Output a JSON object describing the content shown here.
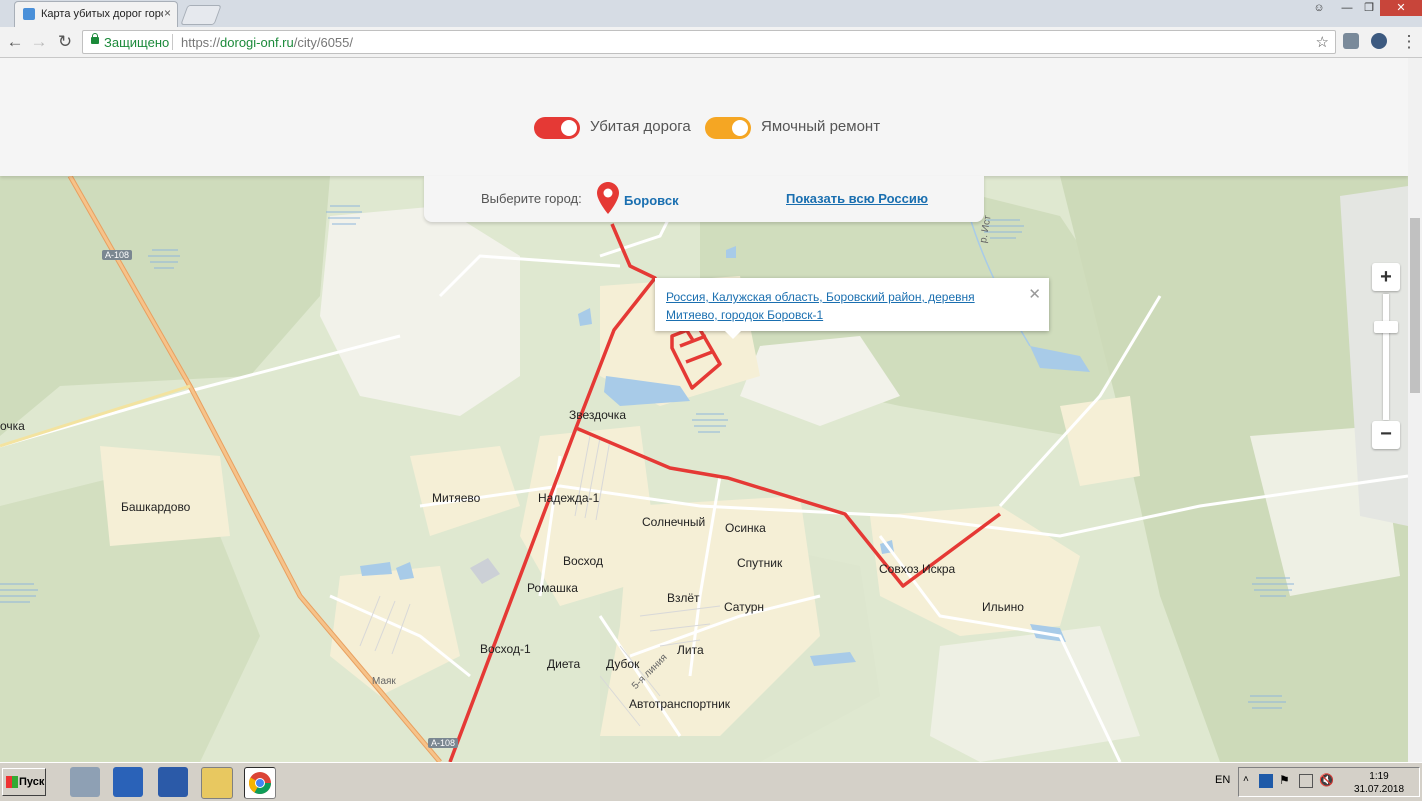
{
  "browser": {
    "tab_title": "Карта убитых дорог город",
    "tab_close": "×",
    "secure_label": "Защищено",
    "url_scheme": "https://",
    "url_host": "dorogi-onf.ru",
    "url_path": "/city/6055/",
    "window_controls": [
      "—",
      "❐",
      "✕"
    ]
  },
  "header": {
    "toggles": [
      {
        "label": "Убитая дорога",
        "color": "#e53935",
        "on": true
      },
      {
        "label": "Ямочный ремонт",
        "color": "#f5a623",
        "on": true
      }
    ]
  },
  "city_selector": {
    "label": "Выберите город:",
    "city": "Боровск",
    "show_all": "Показать всю Россию"
  },
  "balloon": {
    "address": "Россия, Калужская область, Боровский район, деревня Митяево, городок Боровск-1",
    "close": "✕"
  },
  "map": {
    "zoom_in": "+",
    "zoom_out": "−",
    "road_color": "#e53935",
    "labels": {
      "zvezdochka": "Звездочка",
      "mityaevo": "Митяево",
      "nadezhda": "Надежда-1",
      "bashkardovo": "Башкардово",
      "solnechny": "Солнечный",
      "osinka": "Осинка",
      "voskhod": "Восход",
      "sputnik": "Спутник",
      "romashka": "Ромашка",
      "vzlet": "Взлёт",
      "saturn": "Сатурн",
      "sovkhoz": "Совхоз Искра",
      "ilino": "Ильино",
      "voskhod1": "Восход-1",
      "dieta": "Диета",
      "dubok": "Дубок",
      "lita": "Лита",
      "line5": "5-я линия",
      "mayak": "Маяк",
      "avtotrans": "Автотранспортник",
      "ochka": "очка",
      "river": "р. Ист",
      "a108_top": "А-108",
      "a108_bottom": "А-108"
    }
  },
  "taskbar": {
    "start": "Пуск",
    "lang": "EN",
    "time": "1:19",
    "date": "31.07.2018"
  }
}
